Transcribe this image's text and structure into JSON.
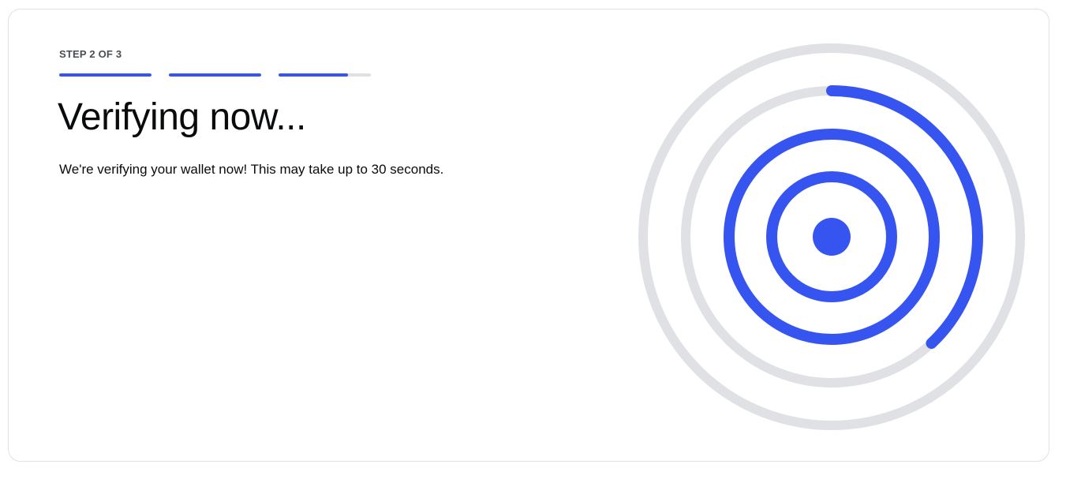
{
  "step": {
    "label": "STEP 2 OF 3",
    "segments": [
      {
        "fill_fraction": 1.0
      },
      {
        "fill_fraction": 1.0
      },
      {
        "fill_fraction": 0.75
      }
    ]
  },
  "main": {
    "title": "Verifying now...",
    "description": "We're verifying your wallet now! This may take up to 30 seconds."
  },
  "illustration": {
    "icon": "radar-scan-icon",
    "outer_ring_progress_fraction": 0.38
  },
  "colors": {
    "accent": "#3554f0",
    "track": "#dfe1e5",
    "text": "#0a0b0d",
    "muted": "#4a4d55"
  }
}
